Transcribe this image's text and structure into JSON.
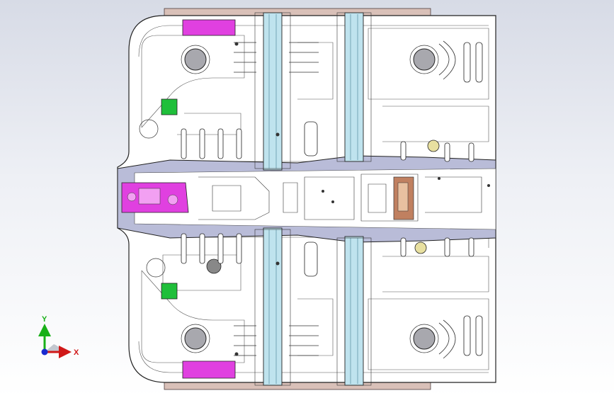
{
  "viewport": {
    "background_top": "#d7dbe6",
    "background_bottom": "#ffffff"
  },
  "model": {
    "part": "vehicle-floor-pan-assembly",
    "colors": {
      "panel_fill": "#ffffff",
      "edge": "#2a2a2a",
      "cross_member": "#bfe3ee",
      "tunnel": "#b9bcd8",
      "magenta_part": "#e040e0",
      "green_part": "#1fbf3a",
      "yellow_part": "#e8e0a0",
      "copper_part": "#c08060"
    }
  },
  "triad": {
    "x_label": "X",
    "y_label": "Y",
    "x_color": "#d01818",
    "y_color": "#18b018",
    "z_color": "#1a2ad0"
  }
}
